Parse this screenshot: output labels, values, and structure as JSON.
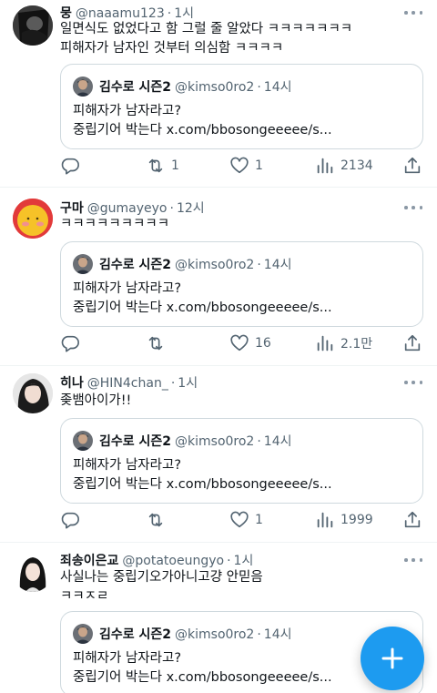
{
  "tweets": [
    {
      "name": "뭉",
      "handle": "@naaamu123",
      "time": "1시",
      "lines": [
        "일면식도 없었다고 함 그럴 줄 알았다 ㅋㅋㅋㅋㅋㅋㅋ",
        "피해자가 남자인 것부터 의심함 ㅋㅋㅋㅋ"
      ],
      "quote": {
        "name": "김수로 시즌2",
        "handle": "@kimso0ro2",
        "time": "14시",
        "lines": [
          "피해자가 남자라고?",
          "중립기어 박는다 x.com/bbosongeeeee/s..."
        ]
      },
      "reply_count": "",
      "retweet_count": "1",
      "like_count": "1",
      "view_count": "2134"
    },
    {
      "name": "구마",
      "handle": "@gumayeyo",
      "time": "12시",
      "lines": [
        "ㅋㅋㅋㅋㅋㅋㅋㅋㅋ"
      ],
      "quote": {
        "name": "김수로 시즌2",
        "handle": "@kimso0ro2",
        "time": "14시",
        "lines": [
          "피해자가 남자라고?",
          "중립기어 박는다 x.com/bbosongeeeee/s..."
        ]
      },
      "reply_count": "",
      "retweet_count": "",
      "like_count": "16",
      "view_count": "2.1만"
    },
    {
      "name": "히나",
      "handle": "@HIN4chan_",
      "time": "1시",
      "lines": [
        "좆뱀아이가!!"
      ],
      "quote": {
        "name": "김수로 시즌2",
        "handle": "@kimso0ro2",
        "time": "14시",
        "lines": [
          "피해자가 남자라고?",
          "중립기어 박는다 x.com/bbosongeeeee/s..."
        ]
      },
      "reply_count": "",
      "retweet_count": "",
      "like_count": "1",
      "view_count": "1999"
    },
    {
      "name": "죄송이은교",
      "handle": "@potatoeungyo",
      "time": "1시",
      "lines": [
        "사실나는 중립기오가아니고걍 안믿음",
        "ㅋㅋㅈㄹ"
      ],
      "quote": {
        "name": "김수로 시즌2",
        "handle": "@kimso0ro2",
        "time": "14시",
        "lines": [
          "피해자가 남자라고?",
          "중립기어 박는다 x.com/bbosongeeeee/s..."
        ]
      }
    }
  ],
  "icons": {
    "reply": "reply-icon",
    "retweet": "retweet-icon",
    "like": "heart-icon",
    "views": "views-icon",
    "share": "share-icon",
    "compose": "plus-icon"
  },
  "colors": {
    "accent": "#1d9bf0",
    "muted": "#536471",
    "border": "#cfd9de"
  }
}
